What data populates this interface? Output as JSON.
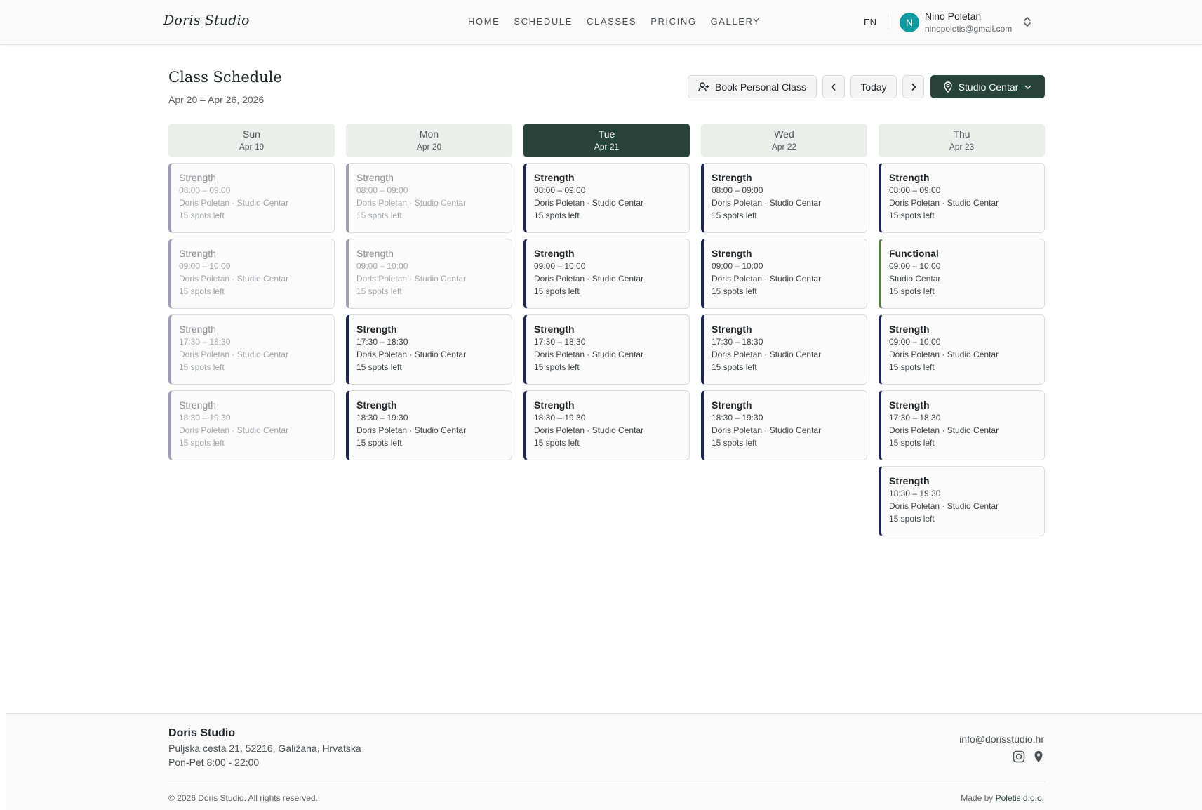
{
  "header": {
    "brand": "Doris Studio",
    "nav": [
      "HOME",
      "SCHEDULE",
      "CLASSES",
      "PRICING",
      "GALLERY"
    ],
    "lang": "EN",
    "user": {
      "initial": "N",
      "name": "Nino Poletan",
      "email": "ninopoletis@gmail.com"
    }
  },
  "page": {
    "title": "Class Schedule",
    "date_range": "Apr 20 – Apr 26, 2026",
    "book_label": "Book Personal Class",
    "today_label": "Today",
    "studio_label": "Studio Centar"
  },
  "days": [
    {
      "name": "Sun",
      "date": "Apr 19",
      "active": false,
      "classes": [
        {
          "title": "Strength",
          "time": "08:00 – 09:00",
          "meta": "Doris Poletan · Studio Centar",
          "spots": "15 spots left",
          "state": "past"
        },
        {
          "title": "Strength",
          "time": "09:00 – 10:00",
          "meta": "Doris Poletan · Studio Centar",
          "spots": "15 spots left",
          "state": "past"
        },
        {
          "title": "Strength",
          "time": "17:30 – 18:30",
          "meta": "Doris Poletan · Studio Centar",
          "spots": "15 spots left",
          "state": "past"
        },
        {
          "title": "Strength",
          "time": "18:30 – 19:30",
          "meta": "Doris Poletan · Studio Centar",
          "spots": "15 spots left",
          "state": "past"
        }
      ]
    },
    {
      "name": "Mon",
      "date": "Apr 20",
      "active": false,
      "classes": [
        {
          "title": "Strength",
          "time": "08:00 – 09:00",
          "meta": "Doris Poletan · Studio Centar",
          "spots": "15 spots left",
          "state": "past"
        },
        {
          "title": "Strength",
          "time": "09:00 – 10:00",
          "meta": "Doris Poletan · Studio Centar",
          "spots": "15 spots left",
          "state": "past"
        },
        {
          "title": "Strength",
          "time": "17:30 – 18:30",
          "meta": "Doris Poletan · Studio Centar",
          "spots": "15 spots left",
          "state": "upcoming"
        },
        {
          "title": "Strength",
          "time": "18:30 – 19:30",
          "meta": "Doris Poletan · Studio Centar",
          "spots": "15 spots left",
          "state": "upcoming"
        }
      ]
    },
    {
      "name": "Tue",
      "date": "Apr 21",
      "active": true,
      "classes": [
        {
          "title": "Strength",
          "time": "08:00 – 09:00",
          "meta": "Doris Poletan · Studio Centar",
          "spots": "15 spots left",
          "state": "upcoming"
        },
        {
          "title": "Strength",
          "time": "09:00 – 10:00",
          "meta": "Doris Poletan · Studio Centar",
          "spots": "15 spots left",
          "state": "upcoming"
        },
        {
          "title": "Strength",
          "time": "17:30 – 18:30",
          "meta": "Doris Poletan · Studio Centar",
          "spots": "15 spots left",
          "state": "upcoming"
        },
        {
          "title": "Strength",
          "time": "18:30 – 19:30",
          "meta": "Doris Poletan · Studio Centar",
          "spots": "15 spots left",
          "state": "upcoming"
        }
      ]
    },
    {
      "name": "Wed",
      "date": "Apr 22",
      "active": false,
      "classes": [
        {
          "title": "Strength",
          "time": "08:00 – 09:00",
          "meta": "Doris Poletan · Studio Centar",
          "spots": "15 spots left",
          "state": "upcoming"
        },
        {
          "title": "Strength",
          "time": "09:00 – 10:00",
          "meta": "Doris Poletan · Studio Centar",
          "spots": "15 spots left",
          "state": "upcoming"
        },
        {
          "title": "Strength",
          "time": "17:30 – 18:30",
          "meta": "Doris Poletan · Studio Centar",
          "spots": "15 spots left",
          "state": "upcoming"
        },
        {
          "title": "Strength",
          "time": "18:30 – 19:30",
          "meta": "Doris Poletan · Studio Centar",
          "spots": "15 spots left",
          "state": "upcoming"
        }
      ]
    },
    {
      "name": "Thu",
      "date": "Apr 23",
      "active": false,
      "classes": [
        {
          "title": "Strength",
          "time": "08:00 – 09:00",
          "meta": "Doris Poletan · Studio Centar",
          "spots": "15 spots left",
          "state": "upcoming"
        },
        {
          "title": "Functional",
          "time": "09:00 – 10:00",
          "meta": "Studio Centar",
          "spots": "15 spots left",
          "state": "functional"
        },
        {
          "title": "Strength",
          "time": "09:00 – 10:00",
          "meta": "Doris Poletan · Studio Centar",
          "spots": "15 spots left",
          "state": "upcoming"
        },
        {
          "title": "Strength",
          "time": "17:30 – 18:30",
          "meta": "Doris Poletan · Studio Centar",
          "spots": "15 spots left",
          "state": "upcoming"
        },
        {
          "title": "Strength",
          "time": "18:30 – 19:30",
          "meta": "Doris Poletan · Studio Centar",
          "spots": "15 spots left",
          "state": "upcoming"
        }
      ]
    }
  ],
  "footer": {
    "name": "Doris Studio",
    "address": "Puljska cesta 21, 52216, Galižana, Hrvatska",
    "hours": "Pon-Pet 8:00 - 22:00",
    "email": "info@dorisstudio.hr",
    "copyright": "© 2026 Doris Studio. All rights reserved.",
    "made_by_prefix": "Made by ",
    "made_by_name": "Poletis d.o.o."
  },
  "icons": {
    "book": "user-plus-icon",
    "prev": "chevron-left-icon",
    "next": "chevron-right-icon",
    "location": "map-pin-icon",
    "dropdown": "chevron-down-icon",
    "user_menu": "chevron-up-down-icon",
    "instagram": "instagram-icon",
    "footer_location": "map-pin-icon"
  },
  "colors": {
    "accent": "#26443a",
    "avatar": "#0e9aa0",
    "class_strength": "#1c2755",
    "class_functional": "#5a7a4a",
    "class_past": "#9aa0b4"
  }
}
